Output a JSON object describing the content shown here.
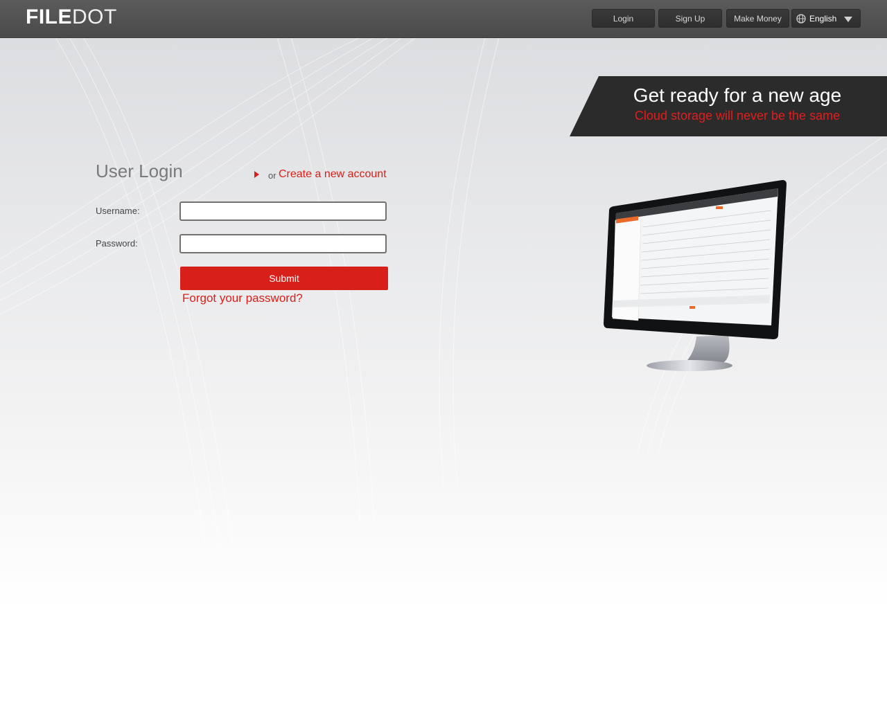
{
  "header": {
    "logo_bold": "FILE",
    "logo_light": "DOT",
    "nav": {
      "login": "Login",
      "signup": "Sign Up",
      "make_money": "Make Money",
      "language": "English"
    }
  },
  "banner": {
    "headline": "Get ready for a new age",
    "subline": "Cloud storage will never be the same"
  },
  "login": {
    "title": "User Login",
    "or_text": "or",
    "create_account": "Create a new account",
    "username_label": "Username:",
    "username_value": "",
    "password_label": "Password:",
    "password_value": "",
    "submit_label": "Submit",
    "forgot_password": "Forgot your password?"
  },
  "colors": {
    "accent": "#d8201a",
    "header_bg": "#4f4f4f",
    "banner_bg": "#2b2b2b"
  },
  "icons": {
    "language": "globe-icon",
    "language_caret": "caret-down-icon",
    "create_account_marker": "triangle-right-icon"
  }
}
